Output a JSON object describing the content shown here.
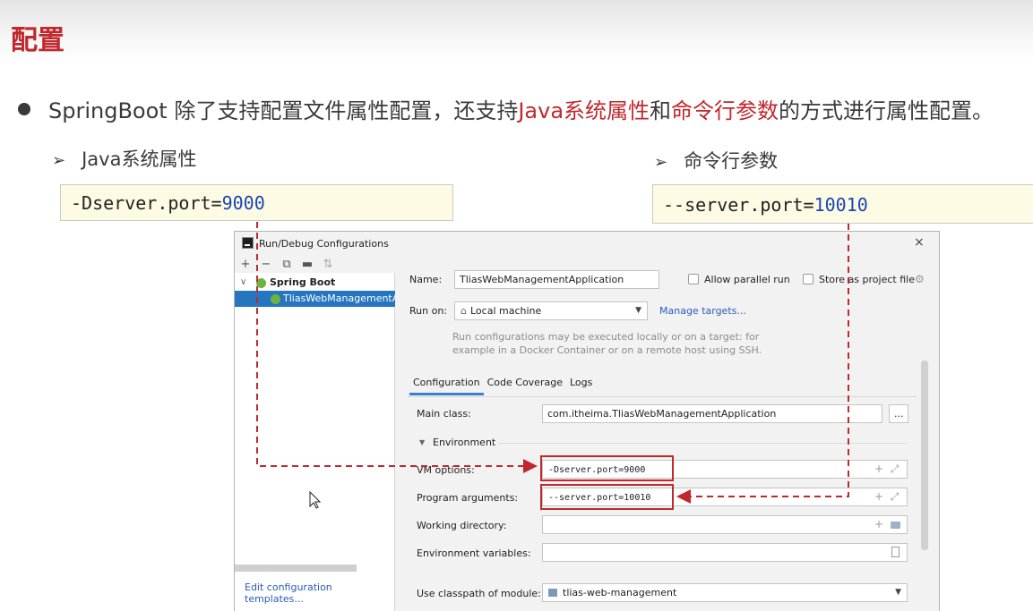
{
  "slide": {
    "title": "配置",
    "bullet": {
      "part1": "SpringBoot 除了支持配置文件属性配置，还支持",
      "highlight1": "Java系统属性",
      "part2": "和",
      "highlight2": "命令行参数",
      "part3": "的方式进行属性配置。"
    },
    "java_props": {
      "arrow": "➢",
      "heading": "Java系统属性",
      "code_prefix": "-Dserver.port=",
      "code_value": "9000"
    },
    "cmd_args": {
      "arrow": "➢",
      "heading": "命令行参数",
      "code_prefix": "--server.port=",
      "code_value": "10010"
    },
    "colors": {
      "accent": "#c0282d",
      "number": "#1b45b5",
      "codebox_bg": "#fdfbe3"
    }
  },
  "dialog": {
    "title": "Run/Debug Configurations",
    "close_icon": "×",
    "toolbar": {
      "add": "+",
      "remove": "−",
      "copy": "⧉",
      "folder": "▬",
      "sort": "⇅"
    },
    "tree": {
      "group_label": "Spring Boot",
      "item_label": "TliasWebManagementA",
      "collapse_arrow": "∨"
    },
    "edit_templates": "Edit configuration templates...",
    "name_label": "Name:",
    "name_value": "TliasWebManagementApplication",
    "allow_parallel": "Allow parallel run",
    "store_project": "Store as project file",
    "run_on_label": "Run on:",
    "run_on_value": "Local machine",
    "manage_targets": "Manage targets...",
    "hint_line1": "Run configurations may be executed locally or on a target: for",
    "hint_line2": "example in a Docker Container or on a remote host using SSH.",
    "tabs": [
      "Configuration",
      "Code Coverage",
      "Logs"
    ],
    "main_class_label": "Main class:",
    "main_class_value": "com.itheima.TliasWebManagementApplication",
    "browse_button": "...",
    "environment_label": "Environment",
    "vm_options_label": "VM options:",
    "vm_options_value": "-Dserver.port=9000",
    "program_args_label": "Program arguments:",
    "program_args_value": "--server.port=10010",
    "working_dir_label": "Working directory:",
    "env_vars_label": "Environment variables:",
    "classpath_label": "Use classpath of module:",
    "classpath_value": "tlias-web-management",
    "field_plus": "+",
    "field_expand": "⤢"
  }
}
